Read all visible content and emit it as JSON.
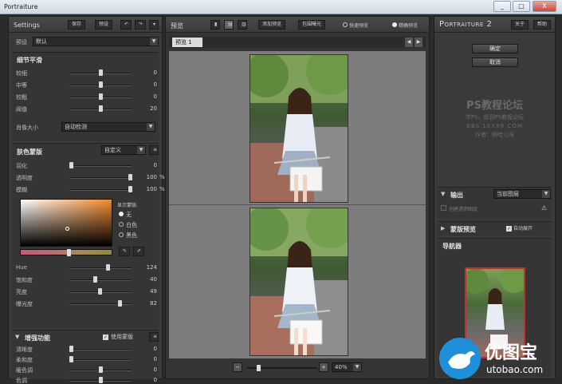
{
  "window": {
    "title": "Portraiture",
    "controls": [
      "_",
      "□",
      "X"
    ]
  },
  "left": {
    "header": {
      "title": "Settings",
      "save": "保存",
      "preset": "预设"
    },
    "preset_row": {
      "label": "预设",
      "value": "默认"
    },
    "detail": {
      "title": "细节平滑",
      "sliders": [
        {
          "label": "较细",
          "value": "0",
          "pos": 0.5
        },
        {
          "label": "中等",
          "value": "0",
          "pos": 0.5
        },
        {
          "label": "较粗",
          "value": "0",
          "pos": 0.5
        },
        {
          "label": "阈值",
          "value": "20",
          "pos": 0.5
        }
      ],
      "size": {
        "label": "肖像大小",
        "value": "自动检测"
      }
    },
    "mask": {
      "title": "肤色蒙版",
      "mode": "自定义",
      "sliders": [
        {
          "label": "羽化",
          "value": "0",
          "pos": 0.0
        },
        {
          "label": "透明度",
          "value": "100",
          "unit": "%",
          "pos": 1.0
        },
        {
          "label": "模糊",
          "value": "100",
          "unit": "%",
          "pos": 1.0
        }
      ],
      "display_label": "显示蒙版:",
      "display_options": [
        "无",
        "白色",
        "黑色"
      ],
      "hsl": [
        {
          "label": "Hue",
          "value": "124",
          "pos": 0.62
        },
        {
          "label": "饱和度",
          "value": "40",
          "pos": 0.4
        },
        {
          "label": "亮度",
          "value": "49",
          "pos": 0.49
        },
        {
          "label": "曝光度",
          "value": "82",
          "pos": 0.82
        }
      ]
    },
    "enhance": {
      "title": "增强功能",
      "use_mask": "使用蒙版",
      "sliders": [
        {
          "label": "清晰度",
          "value": "0",
          "pos": 0.0
        },
        {
          "label": "柔和度",
          "value": "0",
          "pos": 0.0
        },
        {
          "label": "暖色调",
          "value": "0",
          "pos": 0.5
        },
        {
          "label": "色调",
          "value": "0",
          "pos": 0.5
        }
      ]
    }
  },
  "center": {
    "header": {
      "title": "预览",
      "add_preview": "添加预览",
      "choose_mask": "包围曝光",
      "quick_preview": "快速预览",
      "precise_preview": "精确预览"
    },
    "tab": "预览 1",
    "zoom": "40%"
  },
  "right": {
    "brand": {
      "a": "P",
      "b": "ORTRAITURE",
      "c": "2"
    },
    "about": "关于",
    "help": "帮助",
    "ok": "确定",
    "cancel": "取消",
    "watermark": {
      "line1": "PS教程论坛",
      "line2": "学PS，就到PS教程论坛",
      "line3": "BBS.16XX8.COM",
      "line4": "作者：啊哈儿呀"
    },
    "output": {
      "title": "输出",
      "value": "当前图层",
      "option": "创建透明图层"
    },
    "mask_preview": {
      "title": "蒙版预览",
      "auto": "自动展开"
    },
    "navigator": "导航器"
  },
  "watermark_logo": {
    "cn": "优图宝",
    "en": "utobao.com"
  },
  "colors": {
    "accent": "#c03030",
    "panel": "#3a3a3a",
    "dark": "#2b2b2b"
  }
}
